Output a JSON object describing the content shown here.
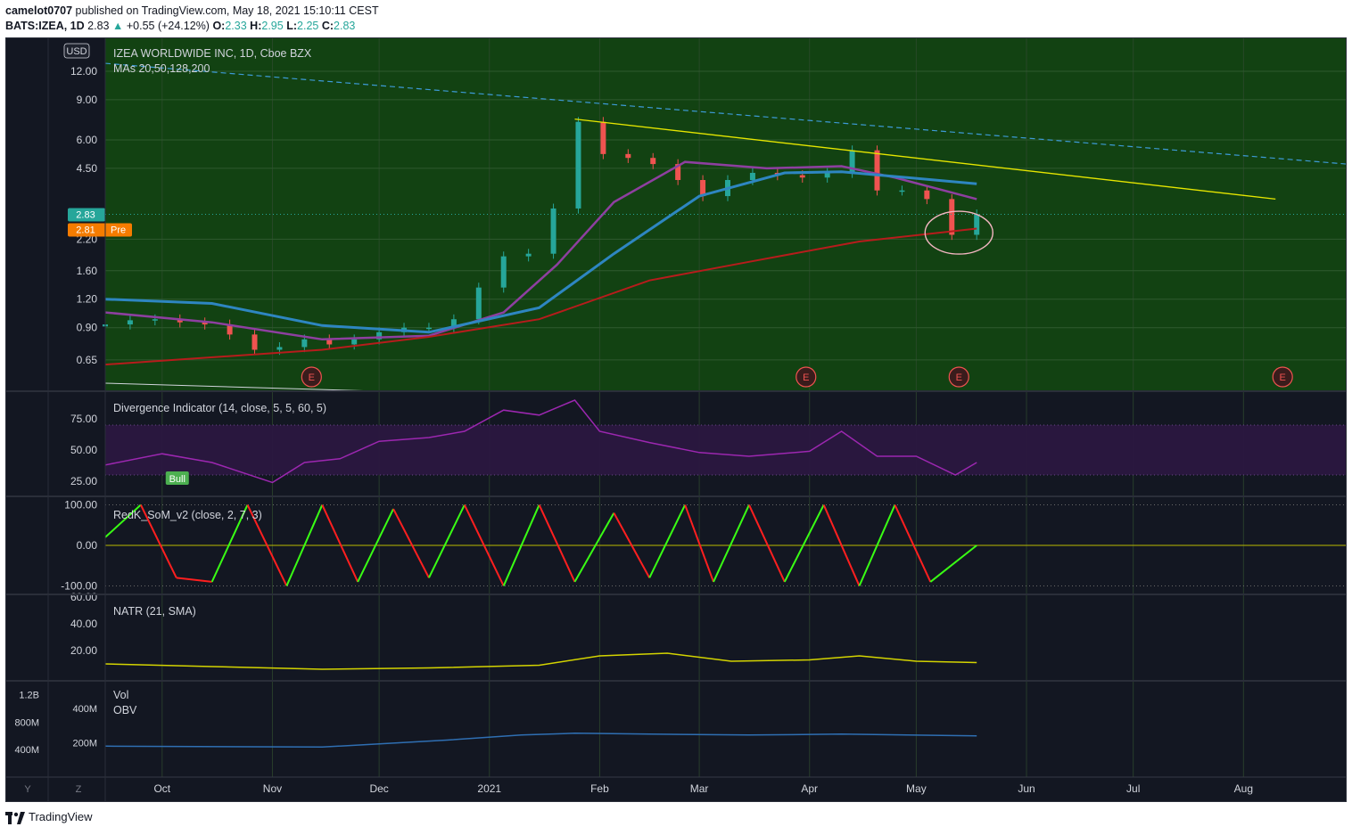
{
  "header": {
    "user": "camelot0707",
    "published": "published on TradingView.com, May 18, 2021 15:10:11 CEST",
    "symbol": "BATS:IZEA, 1D",
    "last": "2.83",
    "change": "+0.55 (+24.12%)",
    "o_label": "O:",
    "o": "2.33",
    "h_label": "H:",
    "h": "2.95",
    "l_label": "L:",
    "l": "2.25",
    "c_label": "C:",
    "c": "2.83"
  },
  "footer": {
    "brand": "TradingView"
  },
  "colors": {
    "price_bg": "#124212",
    "panel_bg": "#131722",
    "grid": "#2a3a2a",
    "up": "#26a69a",
    "down": "#ef5350",
    "ma20": "#8e3fa0",
    "ma50": "#2e86c1",
    "ma200": "#b71c1c",
    "trend": "#e6e600",
    "osc_purple": "#9c27b0",
    "natr": "#d4d400",
    "obv": "#2f6fb3"
  },
  "chart_data": [
    {
      "type": "line",
      "panel": "price",
      "title": "IZEA WORLDWIDE INC, 1D, Cboe BZX",
      "subtitle": "MAs 20,50,128,200",
      "currency_label": "USD",
      "scale": "log",
      "ylim": [
        0.5,
        16
      ],
      "y_ticks": [
        "12.00",
        "9.00",
        "6.00",
        "4.50",
        "2.20",
        "1.60",
        "1.20",
        "0.90",
        "0.65"
      ],
      "y_tick_values": [
        12,
        9,
        6,
        4.5,
        2.2,
        1.6,
        1.2,
        0.9,
        0.65
      ],
      "last_price_label": "2.83",
      "pre_label": "2.81",
      "pre_tag": "Pre",
      "earnings_markers": [
        "E",
        "E",
        "E",
        "E"
      ],
      "earnings_dates": [
        "2020-11-12",
        "2021-03-31",
        "2021-05-13",
        "2021-08-12"
      ],
      "x_ticks": [
        "Oct",
        "Nov",
        "Dec",
        "2021",
        "Feb",
        "Mar",
        "Apr",
        "May",
        "Jun",
        "Jul",
        "Aug"
      ],
      "x_tick_dates": [
        "2020-10-01",
        "2020-11-01",
        "2020-12-01",
        "2021-01-01",
        "2021-02-01",
        "2021-03-01",
        "2021-04-01",
        "2021-05-01",
        "2021-06-01",
        "2021-07-01",
        "2021-08-01"
      ],
      "x_range": [
        "2020-09-15",
        "2021-08-30"
      ],
      "close_series": {
        "dates": [
          "2020-09-15",
          "2020-09-22",
          "2020-09-29",
          "2020-10-06",
          "2020-10-13",
          "2020-10-20",
          "2020-10-27",
          "2020-11-03",
          "2020-11-10",
          "2020-11-17",
          "2020-11-24",
          "2020-12-01",
          "2020-12-08",
          "2020-12-15",
          "2020-12-22",
          "2020-12-29",
          "2021-01-05",
          "2021-01-12",
          "2021-01-19",
          "2021-01-26",
          "2021-02-02",
          "2021-02-09",
          "2021-02-16",
          "2021-02-23",
          "2021-03-02",
          "2021-03-09",
          "2021-03-16",
          "2021-03-23",
          "2021-03-30",
          "2021-04-06",
          "2021-04-13",
          "2021-04-20",
          "2021-04-27",
          "2021-05-04",
          "2021-05-11",
          "2021-05-18"
        ],
        "close": [
          0.93,
          0.97,
          0.98,
          0.95,
          0.93,
          0.84,
          0.72,
          0.74,
          0.8,
          0.76,
          0.8,
          0.86,
          0.9,
          0.9,
          0.98,
          1.35,
          1.85,
          1.9,
          3.0,
          7.2,
          5.2,
          5.0,
          4.7,
          4.0,
          3.4,
          4.0,
          4.3,
          4.2,
          4.1,
          4.3,
          5.4,
          3.6,
          3.6,
          3.3,
          2.3,
          2.83
        ]
      },
      "ma_series": [
        {
          "name": "MA20",
          "dates": [
            "2020-09-15",
            "2020-10-15",
            "2020-11-15",
            "2020-12-15",
            "2021-01-05",
            "2021-01-20",
            "2021-02-05",
            "2021-02-25",
            "2021-03-20",
            "2021-04-10",
            "2021-04-25",
            "2021-05-18"
          ],
          "values": [
            1.05,
            0.95,
            0.8,
            0.83,
            1.05,
            1.7,
            3.2,
            4.8,
            4.5,
            4.6,
            4.1,
            3.3
          ]
        },
        {
          "name": "MA50",
          "dates": [
            "2020-09-15",
            "2020-10-15",
            "2020-11-15",
            "2020-12-15",
            "2021-01-15",
            "2021-02-05",
            "2021-03-01",
            "2021-03-25",
            "2021-04-10",
            "2021-05-18"
          ],
          "values": [
            1.2,
            1.15,
            0.92,
            0.86,
            1.1,
            1.9,
            3.4,
            4.3,
            4.35,
            3.85
          ]
        },
        {
          "name": "MA200",
          "dates": [
            "2020-09-15",
            "2020-11-15",
            "2020-12-15",
            "2021-01-15",
            "2021-02-15",
            "2021-03-15",
            "2021-04-15",
            "2021-05-18"
          ],
          "values": [
            0.62,
            0.72,
            0.82,
            0.98,
            1.45,
            1.75,
            2.15,
            2.45
          ]
        }
      ],
      "trendlines": [
        {
          "from": [
            "2021-01-25",
            7.4
          ],
          "to": [
            "2021-08-10",
            3.3
          ]
        },
        {
          "from": [
            "2020-09-15",
            13.0
          ],
          "to": [
            "2021-08-30",
            4.7
          ]
        }
      ]
    },
    {
      "type": "line",
      "panel": "divergence",
      "title": "Divergence Indicator (14, close, 5, 5, 60, 5)",
      "y_ticks": [
        "75.00",
        "50.00",
        "25.00"
      ],
      "y_tick_values": [
        75,
        50,
        25
      ],
      "ylim": [
        15,
        95
      ],
      "band": [
        30,
        70
      ],
      "bull_label": "Bull",
      "dates": [
        "2020-09-15",
        "2020-10-01",
        "2020-10-15",
        "2020-11-01",
        "2020-11-10",
        "2020-11-20",
        "2020-12-01",
        "2020-12-15",
        "2020-12-25",
        "2021-01-05",
        "2021-01-15",
        "2021-01-25",
        "2021-02-01",
        "2021-02-15",
        "2021-03-01",
        "2021-03-15",
        "2021-04-01",
        "2021-04-10",
        "2021-04-20",
        "2021-05-01",
        "2021-05-12",
        "2021-05-18"
      ],
      "values": [
        38,
        47,
        40,
        24,
        40,
        43,
        57,
        60,
        65,
        82,
        78,
        90,
        65,
        56,
        48,
        45,
        49,
        65,
        45,
        45,
        30,
        40
      ]
    },
    {
      "type": "line",
      "panel": "somv2",
      "title": "RedK_SoM_v2 (close, 2, 7, 3)",
      "y_ticks": [
        "100.00",
        "0.00",
        "-100.00"
      ],
      "y_tick_values": [
        100,
        0,
        -100
      ],
      "ylim": [
        -110,
        110
      ],
      "dates": [
        "2020-09-15",
        "2020-09-25",
        "2020-10-05",
        "2020-10-15",
        "2020-10-25",
        "2020-11-05",
        "2020-11-15",
        "2020-11-25",
        "2020-12-05",
        "2020-12-15",
        "2020-12-25",
        "2021-01-05",
        "2021-01-15",
        "2021-01-25",
        "2021-02-05",
        "2021-02-15",
        "2021-02-25",
        "2021-03-05",
        "2021-03-15",
        "2021-03-25",
        "2021-04-05",
        "2021-04-15",
        "2021-04-25",
        "2021-05-05",
        "2021-05-18"
      ],
      "values": [
        20,
        100,
        -80,
        -90,
        100,
        -100,
        100,
        -90,
        90,
        -80,
        100,
        -100,
        100,
        -90,
        80,
        -80,
        100,
        -90,
        100,
        -90,
        100,
        -100,
        100,
        -90,
        0
      ]
    },
    {
      "type": "line",
      "panel": "natr",
      "title": "NATR (21, SMA)",
      "y_ticks": [
        "60.00",
        "40.00",
        "20.00"
      ],
      "y_tick_values": [
        60,
        40,
        20
      ],
      "ylim": [
        0,
        60
      ],
      "dates": [
        "2020-09-15",
        "2020-10-15",
        "2020-11-15",
        "2020-12-15",
        "2021-01-15",
        "2021-02-01",
        "2021-02-20",
        "2021-03-10",
        "2021-04-01",
        "2021-04-15",
        "2021-05-01",
        "2021-05-18"
      ],
      "values": [
        10,
        8,
        6,
        7,
        9,
        16,
        18,
        12,
        13,
        16,
        12,
        11
      ]
    },
    {
      "type": "area",
      "panel": "volume",
      "title": "Vol",
      "obv_label": "OBV",
      "left_y_ticks": [
        "1.2B",
        "800M",
        "400M"
      ],
      "left_y_tick_values": [
        1200,
        800,
        400
      ],
      "right_y_ticks": [
        "400M",
        "200M"
      ],
      "right_y_tick_values": [
        400,
        200
      ],
      "obv_dates": [
        "2020-09-15",
        "2020-11-15",
        "2020-12-20",
        "2021-01-10",
        "2021-01-25",
        "2021-02-15",
        "2021-03-15",
        "2021-04-10",
        "2021-05-18"
      ],
      "obv_values": [
        180,
        175,
        215,
        245,
        255,
        250,
        245,
        250,
        240
      ]
    }
  ],
  "scale_buttons": [
    "Y",
    "Z"
  ]
}
